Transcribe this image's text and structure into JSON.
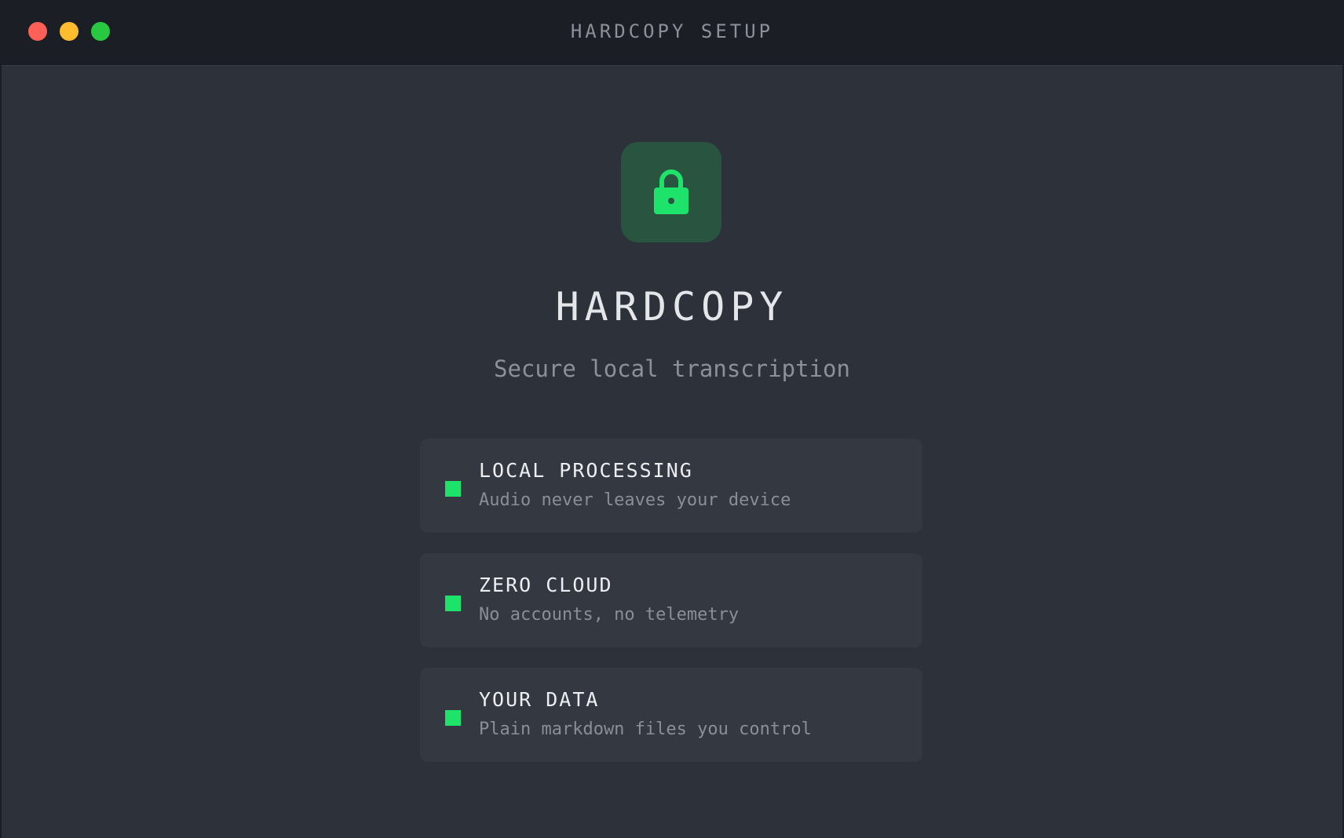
{
  "window": {
    "title": "HARDCOPY SETUP"
  },
  "hero": {
    "icon": "lock-icon",
    "app_name": "HARDCOPY",
    "tagline": "Secure local transcription"
  },
  "features": [
    {
      "title": "LOCAL PROCESSING",
      "description": "Audio never leaves your device"
    },
    {
      "title": "ZERO CLOUD",
      "description": "No accounts, no telemetry"
    },
    {
      "title": "YOUR DATA",
      "description": "Plain markdown files you control"
    }
  ],
  "colors": {
    "accent": "#1ee36a",
    "background": "#2d323a",
    "titlebar": "#1b1e25",
    "card": "#343840",
    "close": "#fe5f57",
    "minimize": "#febc2e",
    "maximize": "#28c840"
  }
}
